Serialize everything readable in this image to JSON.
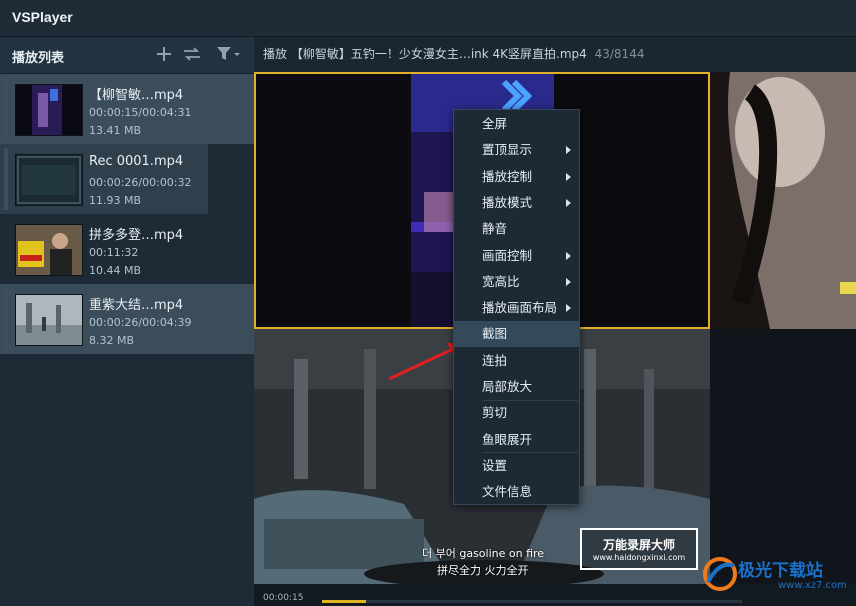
{
  "app": {
    "title": "VSPlayer"
  },
  "sidebar": {
    "title": "播放列表",
    "items": [
      {
        "name": "【柳智敏…mp4",
        "time": "00:00:15/00:04:31",
        "size": "13.41 MB"
      },
      {
        "name": "Rec 0001.mp4",
        "time": "00:00:26/00:00:32",
        "size": "11.93 MB"
      },
      {
        "name": "拼多多登…mp4",
        "time": "00:11:32",
        "size": "10.44 MB"
      },
      {
        "name": "重紫大结…mp4",
        "time": "00:00:26/00:04:39",
        "size": "8.32 MB"
      }
    ]
  },
  "now_playing": {
    "title": "播放 【柳智敏】五钓一！少女漫女主…ink 4K竖屏直拍.mp4",
    "counter": "43/8144"
  },
  "video": {
    "subtitle_line1": "더 부어 gasoline on fire",
    "subtitle_line2": "拼尽全力 火力全开",
    "watermark_title": "万能录屏大师",
    "watermark_url": "www.haidongxinxi.com"
  },
  "site_watermark": {
    "name": "极光下载站",
    "url": "www.xz7.com"
  },
  "playback": {
    "elapsed": "00:00:15",
    "progress": 0.105
  },
  "context_menu": {
    "items": [
      {
        "label": "全屏",
        "submenu": false
      },
      {
        "label": "置顶显示",
        "submenu": true
      },
      {
        "label": "播放控制",
        "submenu": true
      },
      {
        "label": "播放模式",
        "submenu": true
      },
      {
        "label": "静音",
        "submenu": false
      },
      {
        "label": "画面控制",
        "submenu": true
      },
      {
        "label": "宽高比",
        "submenu": true
      },
      {
        "label": "播放画面布局",
        "submenu": true
      },
      {
        "label": "截图",
        "submenu": false,
        "highlighted": true
      },
      {
        "label": "连拍",
        "submenu": false
      },
      {
        "label": "局部放大",
        "submenu": false
      },
      {
        "label": "剪切",
        "submenu": false
      },
      {
        "label": "鱼眼展开",
        "submenu": false
      },
      {
        "label": "设置",
        "submenu": false
      },
      {
        "label": "文件信息",
        "submenu": false
      }
    ]
  },
  "colors": {
    "accent": "#e1b12c",
    "annotation_arrow": "#e02020"
  },
  "icons": [
    "add-icon",
    "shuffle-icon",
    "filter-icon",
    "chevron-left-icon",
    "submenu-arrow-icon"
  ]
}
